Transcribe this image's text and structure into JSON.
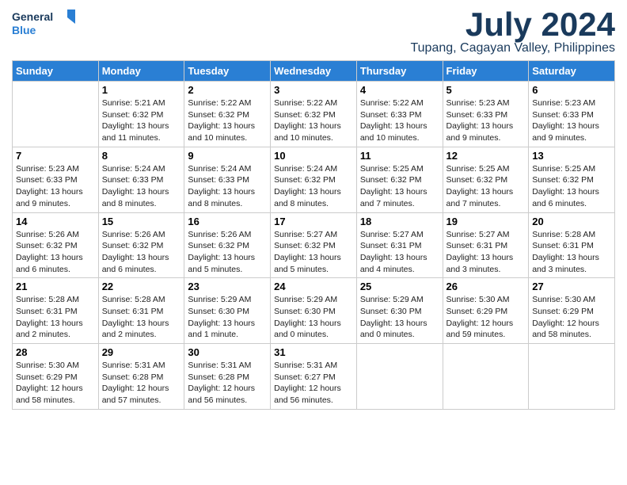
{
  "logo": {
    "line1": "General",
    "line2": "Blue"
  },
  "title": "July 2024",
  "location": "Tupang, Cagayan Valley, Philippines",
  "days_header": [
    "Sunday",
    "Monday",
    "Tuesday",
    "Wednesday",
    "Thursday",
    "Friday",
    "Saturday"
  ],
  "weeks": [
    [
      {
        "num": "",
        "info": ""
      },
      {
        "num": "1",
        "info": "Sunrise: 5:21 AM\nSunset: 6:32 PM\nDaylight: 13 hours\nand 11 minutes."
      },
      {
        "num": "2",
        "info": "Sunrise: 5:22 AM\nSunset: 6:32 PM\nDaylight: 13 hours\nand 10 minutes."
      },
      {
        "num": "3",
        "info": "Sunrise: 5:22 AM\nSunset: 6:32 PM\nDaylight: 13 hours\nand 10 minutes."
      },
      {
        "num": "4",
        "info": "Sunrise: 5:22 AM\nSunset: 6:33 PM\nDaylight: 13 hours\nand 10 minutes."
      },
      {
        "num": "5",
        "info": "Sunrise: 5:23 AM\nSunset: 6:33 PM\nDaylight: 13 hours\nand 9 minutes."
      },
      {
        "num": "6",
        "info": "Sunrise: 5:23 AM\nSunset: 6:33 PM\nDaylight: 13 hours\nand 9 minutes."
      }
    ],
    [
      {
        "num": "7",
        "info": "Sunrise: 5:23 AM\nSunset: 6:33 PM\nDaylight: 13 hours\nand 9 minutes."
      },
      {
        "num": "8",
        "info": "Sunrise: 5:24 AM\nSunset: 6:33 PM\nDaylight: 13 hours\nand 8 minutes."
      },
      {
        "num": "9",
        "info": "Sunrise: 5:24 AM\nSunset: 6:33 PM\nDaylight: 13 hours\nand 8 minutes."
      },
      {
        "num": "10",
        "info": "Sunrise: 5:24 AM\nSunset: 6:32 PM\nDaylight: 13 hours\nand 8 minutes."
      },
      {
        "num": "11",
        "info": "Sunrise: 5:25 AM\nSunset: 6:32 PM\nDaylight: 13 hours\nand 7 minutes."
      },
      {
        "num": "12",
        "info": "Sunrise: 5:25 AM\nSunset: 6:32 PM\nDaylight: 13 hours\nand 7 minutes."
      },
      {
        "num": "13",
        "info": "Sunrise: 5:25 AM\nSunset: 6:32 PM\nDaylight: 13 hours\nand 6 minutes."
      }
    ],
    [
      {
        "num": "14",
        "info": "Sunrise: 5:26 AM\nSunset: 6:32 PM\nDaylight: 13 hours\nand 6 minutes."
      },
      {
        "num": "15",
        "info": "Sunrise: 5:26 AM\nSunset: 6:32 PM\nDaylight: 13 hours\nand 6 minutes."
      },
      {
        "num": "16",
        "info": "Sunrise: 5:26 AM\nSunset: 6:32 PM\nDaylight: 13 hours\nand 5 minutes."
      },
      {
        "num": "17",
        "info": "Sunrise: 5:27 AM\nSunset: 6:32 PM\nDaylight: 13 hours\nand 5 minutes."
      },
      {
        "num": "18",
        "info": "Sunrise: 5:27 AM\nSunset: 6:31 PM\nDaylight: 13 hours\nand 4 minutes."
      },
      {
        "num": "19",
        "info": "Sunrise: 5:27 AM\nSunset: 6:31 PM\nDaylight: 13 hours\nand 3 minutes."
      },
      {
        "num": "20",
        "info": "Sunrise: 5:28 AM\nSunset: 6:31 PM\nDaylight: 13 hours\nand 3 minutes."
      }
    ],
    [
      {
        "num": "21",
        "info": "Sunrise: 5:28 AM\nSunset: 6:31 PM\nDaylight: 13 hours\nand 2 minutes."
      },
      {
        "num": "22",
        "info": "Sunrise: 5:28 AM\nSunset: 6:31 PM\nDaylight: 13 hours\nand 2 minutes."
      },
      {
        "num": "23",
        "info": "Sunrise: 5:29 AM\nSunset: 6:30 PM\nDaylight: 13 hours\nand 1 minute."
      },
      {
        "num": "24",
        "info": "Sunrise: 5:29 AM\nSunset: 6:30 PM\nDaylight: 13 hours\nand 0 minutes."
      },
      {
        "num": "25",
        "info": "Sunrise: 5:29 AM\nSunset: 6:30 PM\nDaylight: 13 hours\nand 0 minutes."
      },
      {
        "num": "26",
        "info": "Sunrise: 5:30 AM\nSunset: 6:29 PM\nDaylight: 12 hours\nand 59 minutes."
      },
      {
        "num": "27",
        "info": "Sunrise: 5:30 AM\nSunset: 6:29 PM\nDaylight: 12 hours\nand 58 minutes."
      }
    ],
    [
      {
        "num": "28",
        "info": "Sunrise: 5:30 AM\nSunset: 6:29 PM\nDaylight: 12 hours\nand 58 minutes."
      },
      {
        "num": "29",
        "info": "Sunrise: 5:31 AM\nSunset: 6:28 PM\nDaylight: 12 hours\nand 57 minutes."
      },
      {
        "num": "30",
        "info": "Sunrise: 5:31 AM\nSunset: 6:28 PM\nDaylight: 12 hours\nand 56 minutes."
      },
      {
        "num": "31",
        "info": "Sunrise: 5:31 AM\nSunset: 6:27 PM\nDaylight: 12 hours\nand 56 minutes."
      },
      {
        "num": "",
        "info": ""
      },
      {
        "num": "",
        "info": ""
      },
      {
        "num": "",
        "info": ""
      }
    ]
  ]
}
